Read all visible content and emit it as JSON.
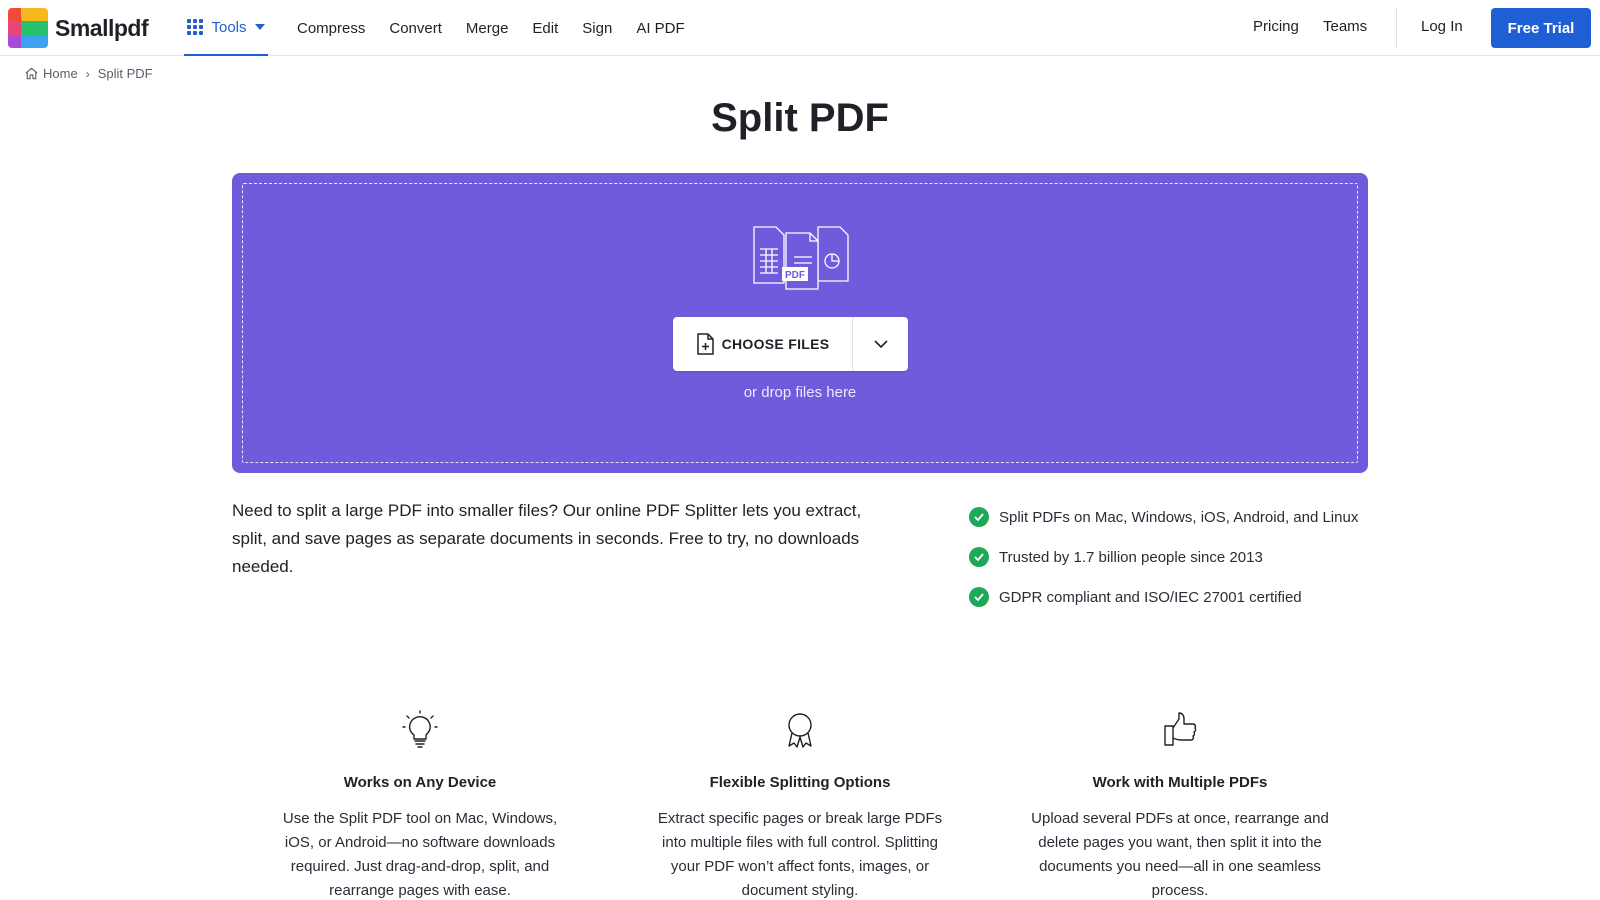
{
  "header": {
    "logo_text": "Smallpdf",
    "logo_colors": [
      "#ef4b36",
      "#f7b81e",
      "#f7b81e",
      "#e8457b",
      "#26c26b",
      "#26c26b",
      "#a94bd6",
      "#3da0f0",
      "#3da0f0"
    ],
    "tools_label": "Tools",
    "nav": [
      "Compress",
      "Convert",
      "Merge",
      "Edit",
      "Sign",
      "AI PDF"
    ],
    "pricing": "Pricing",
    "teams": "Teams",
    "login": "Log In",
    "free_trial": "Free Trial"
  },
  "breadcrumb": {
    "home": "Home",
    "separator": "›",
    "current": "Split PDF"
  },
  "page_title": "Split PDF",
  "dropzone": {
    "choose_files": "CHOOSE FILES",
    "pdf_tag": "PDF",
    "drop_hint": "or drop files here",
    "bg_color": "#6f5bdc"
  },
  "description": "Need to split a large PDF into smaller files? Our online PDF Splitter lets you extract, split, and save pages as separate documents in seconds. Free to try, no downloads needed.",
  "features": [
    "Split PDFs on Mac, Windows, iOS, Android, and Linux",
    "Trusted by 1.7 billion people since 2013",
    "GDPR compliant and ISO/IEC 27001 certified"
  ],
  "columns": [
    {
      "icon": "lightbulb-icon",
      "title": "Works on Any Device",
      "text": "Use the Split PDF tool on Mac, Windows, iOS, or Android—no software downloads required. Just drag-and-drop, split, and rearrange pages with ease."
    },
    {
      "icon": "award-ribbon-icon",
      "title": "Flexible Splitting Options",
      "text": "Extract specific pages or break large PDFs into multiple files with full control. Splitting your PDF won’t affect fonts, images, or document styling."
    },
    {
      "icon": "thumbs-up-icon",
      "title": "Work with Multiple PDFs",
      "text": "Upload several PDFs at once, rearrange and delete pages you want, then split it into the documents you need—all in one seamless process."
    }
  ],
  "colors": {
    "accent": "#1f5fd6",
    "check": "#1ea85a"
  }
}
